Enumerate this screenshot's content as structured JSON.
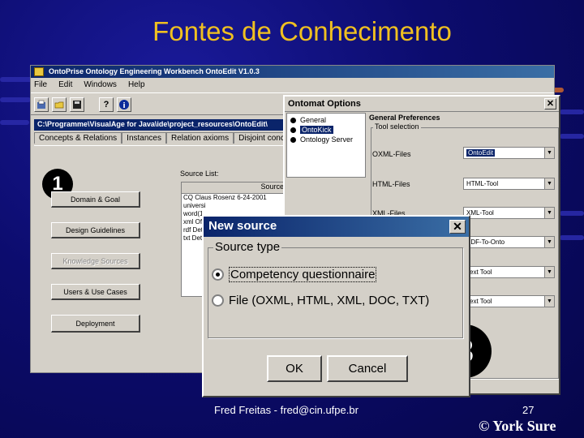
{
  "slide": {
    "title": "Fontes de Conhecimento",
    "footer": "Fred Freitas - fred@cin.ufpe.br",
    "page_number": "27",
    "copyright": "© York Sure"
  },
  "main_window": {
    "title": "OntoPrise Ontology Engineering Workbench OntoEdit V1.0.3",
    "menu": [
      "File",
      "Edit",
      "Windows",
      "Help"
    ],
    "toolbar_icons": [
      "new-icon",
      "open-folder-icon",
      "save-icon",
      "help-icon",
      "info-icon"
    ],
    "path": "C:\\Programme\\VisualAge for Java\\ide\\project_resources\\OntoEdit\\",
    "tabs": [
      "Concepts & Relations",
      "Instances",
      "Relation axioms",
      "Disjoint concepts"
    ],
    "step_badge": "1",
    "buttons": [
      {
        "label": "Domain & Goal",
        "disabled": false
      },
      {
        "label": "Design Guidelines",
        "disabled": false
      },
      {
        "label": "Knowledge Sources",
        "disabled": true
      },
      {
        "label": "Users & Use Cases",
        "disabled": false
      },
      {
        "label": "Deployment",
        "disabled": false
      }
    ],
    "source_list": {
      "label": "Source List:",
      "column_header": "Source",
      "rows": [
        "CQ Claus Rosenz 6-24-2001",
        "universi",
        "word(1",
        "xml Of",
        "rdf Det",
        "txt Det"
      ]
    }
  },
  "options_window": {
    "title": "Ontomat Options",
    "tree": [
      "General",
      "OntoKick",
      "Ontology Server"
    ],
    "selected_tree_index": 1,
    "section_title": "General Preferences",
    "group_title": "Tool selection",
    "rows": [
      {
        "label": "OXML-Files",
        "value": "OntoEdit",
        "highlighted": true
      },
      {
        "label": "HTML-Files",
        "value": "HTML-Tool",
        "highlighted": false
      },
      {
        "label": "XML-Files",
        "value": "XML-Tool",
        "highlighted": false
      },
      {
        "label": "",
        "value": "PDF-To-Onto",
        "highlighted": false
      },
      {
        "label": "",
        "value": "Text Tool",
        "highlighted": false
      },
      {
        "label": "",
        "value": "Text Tool",
        "highlighted": false
      }
    ]
  },
  "new_source_dialog": {
    "title": "New source",
    "group_title": "Source type",
    "options": [
      "Competency questionnaire",
      "File (OXML, HTML, XML, DOC, TXT)"
    ],
    "selected_index": 0,
    "ok_label": "OK",
    "cancel_label": "Cancel",
    "step_badge": "3"
  },
  "colors": {
    "title_text": "#f0c020",
    "background": "#0c0c6e",
    "selection": "#0a246a"
  }
}
